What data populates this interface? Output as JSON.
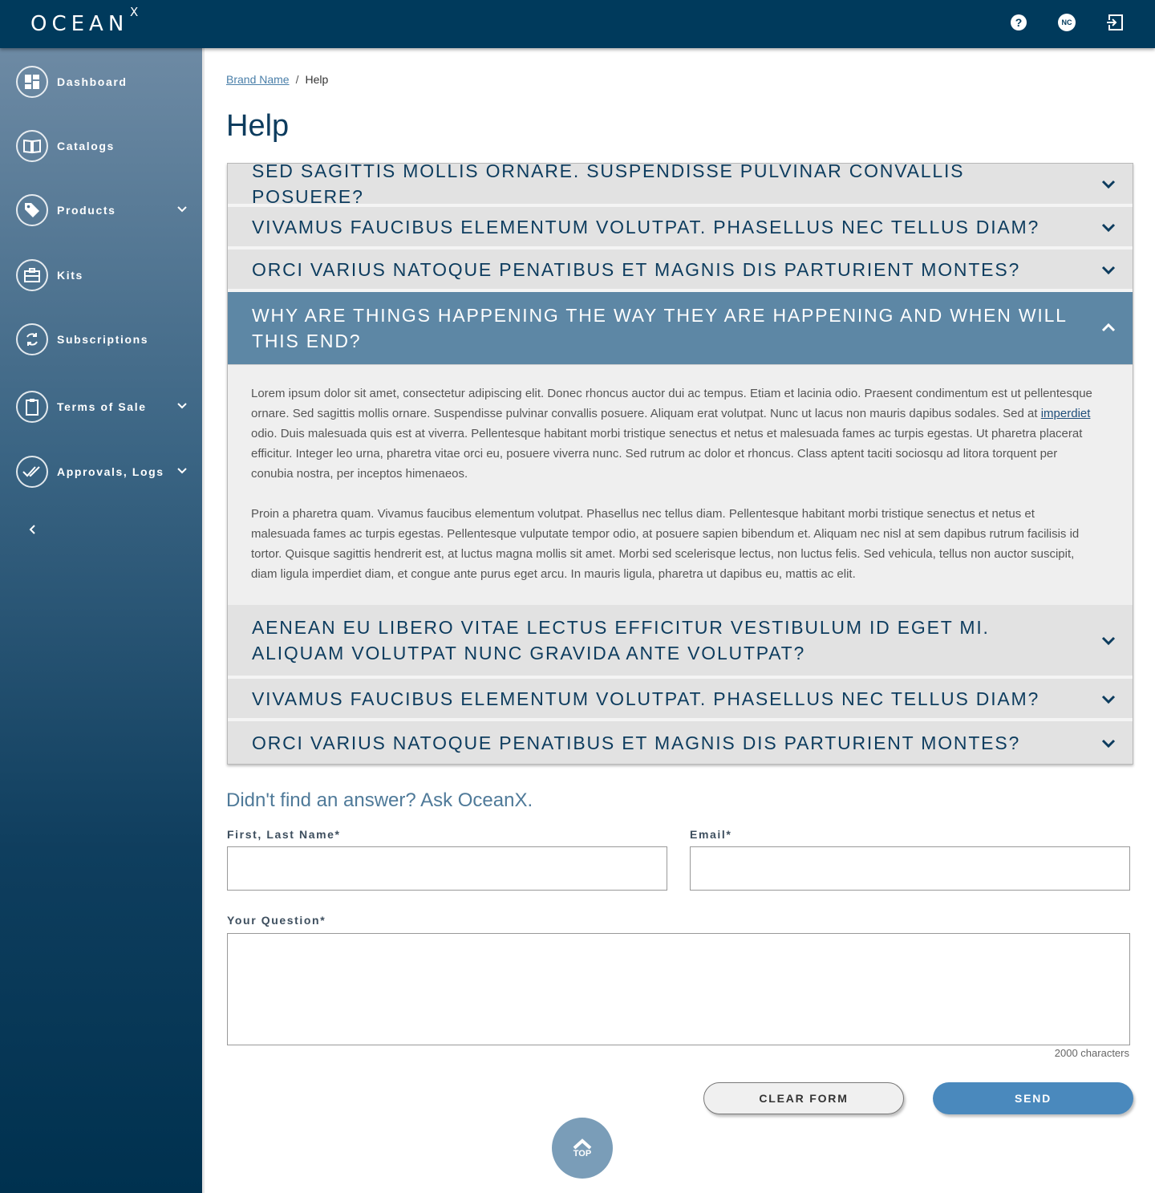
{
  "app": {
    "logo_text": "OCEAN",
    "logo_suffix": "X",
    "user_initials": "NC"
  },
  "colors": {
    "topbar": "#003a5c",
    "sidebar_top": "#6d8aa4",
    "sidebar_bottom": "#00314f",
    "accent": "#4a89bd",
    "open_question": "#5d87a5"
  },
  "sidebar": {
    "items": [
      {
        "label": "Dashboard",
        "icon": "dashboard-icon"
      },
      {
        "label": "Catalogs",
        "icon": "book-icon"
      },
      {
        "label": "Products",
        "icon": "tag-icon",
        "expandable": true
      },
      {
        "label": "Kits",
        "icon": "briefcase-icon"
      },
      {
        "label": "Subscriptions",
        "icon": "refresh-icon"
      },
      {
        "label": "Terms of Sale",
        "icon": "clipboard-icon",
        "expandable": true
      },
      {
        "label": "Approvals, Logs",
        "icon": "double-check-icon",
        "expandable": true
      }
    ]
  },
  "breadcrumb": {
    "brand": "Brand Name",
    "separator": "/",
    "current": "Help"
  },
  "page": {
    "title": "Help"
  },
  "faq": [
    {
      "question": "Sed sagittis mollis ornare. Suspendisse pulvinar convallis posuere?",
      "open": false
    },
    {
      "question": "Vivamus faucibus elementum volutpat. Phasellus nec tellus diam?",
      "open": false
    },
    {
      "question": "Orci varius natoque penatibus et magnis dis parturient montes?",
      "open": false
    },
    {
      "question": "Why are things happening the way they are happening and when will this end?",
      "open": true,
      "answer": {
        "p1_before_link": "Lorem ipsum dolor sit amet, consectetur adipiscing elit. Donec rhoncus auctor dui ac tempus. Etiam et lacinia odio. Praesent condimentum est ut pellentesque ornare. Sed sagittis mollis ornare. Suspendisse pulvinar convallis posuere. Aliquam erat volutpat. Nunc ut lacus non mauris dapibus sodales. Sed at ",
        "p1_link": "imperdiet",
        "p1_after_link": " odio. Duis malesuada quis est at viverra. Pellentesque habitant morbi tristique senectus et netus et malesuada fames ac turpis egestas. Ut pharetra placerat efficitur. Integer leo urna, pharetra vitae orci eu, posuere viverra nunc. Sed rutrum ac dolor et rhoncus. Class aptent taciti sociosqu ad litora torquent per conubia nostra, per inceptos himenaeos.",
        "p2": "Proin a pharetra quam. Vivamus faucibus elementum volutpat. Phasellus nec tellus diam. Pellentesque habitant morbi tristique senectus et netus et malesuada fames ac turpis egestas. Pellentesque vulputate tempor odio, at posuere sapien bibendum et. Aliquam nec nisl at sem dapibus rutrum facilisis id tortor. Quisque sagittis hendrerit est, at luctus magna mollis sit amet. Morbi sed scelerisque lectus, non luctus felis. Sed vehicula, tellus non auctor suscipit, diam ligula imperdiet diam, et congue ante purus eget arcu. In mauris ligula, pharetra ut dapibus eu, mattis ac elit."
      }
    },
    {
      "question": "Aenean eu libero vitae lectus efficitur vestibulum id eget mi. Aliquam volutpat nunc gravida ante volutpat?",
      "open": false
    },
    {
      "question": "Vivamus faucibus elementum volutpat. Phasellus nec tellus diam?",
      "open": false
    },
    {
      "question": "Orci varius natoque penatibus et magnis dis parturient montes?",
      "open": false
    }
  ],
  "ask": {
    "title": "Didn't find an answer? Ask OceanX.",
    "name_label": "First, Last Name*",
    "name_value": "",
    "email_label": "Email*",
    "email_value": "",
    "question_label": "Your Question*",
    "question_value": "",
    "char_limit": "2000 characters",
    "clear_label": "CLEAR FORM",
    "send_label": "SEND"
  },
  "top_button": {
    "label": "TOP"
  }
}
